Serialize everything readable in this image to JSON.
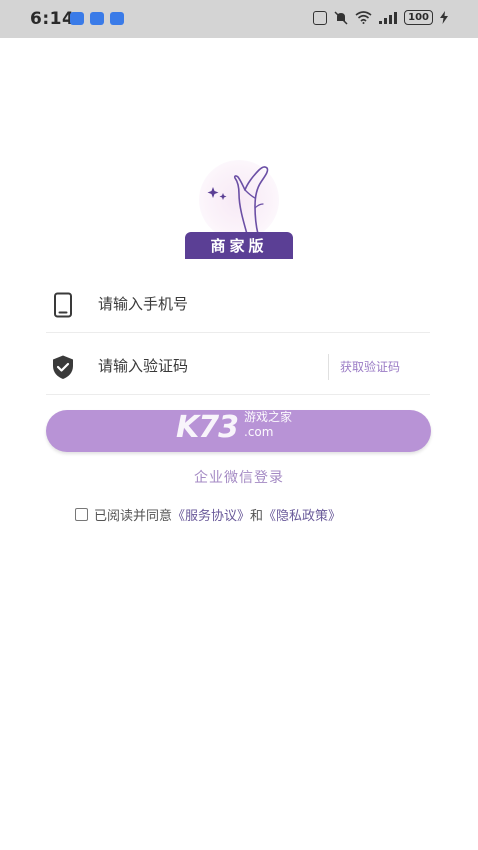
{
  "status_bar": {
    "time": "6:14",
    "battery": "100"
  },
  "logo": {
    "label": "商家版"
  },
  "login_form": {
    "phone_placeholder": "请输入手机号",
    "code_placeholder": "请输入验证码",
    "get_code_label": "获取验证码"
  },
  "watermark": {
    "brand": "K73",
    "line1": "游戏之家",
    "line2": ".com"
  },
  "wechat_login_label": "企业微信登录",
  "agreement": {
    "prefix": "已阅读并同意",
    "service_link": "《服务协议》",
    "conjunction": "和",
    "privacy_link": "《隐私政策》"
  },
  "colors": {
    "brand_purple": "#5b3f95",
    "button_purple": "#b893d6",
    "link_purple": "#9a7bc5"
  }
}
